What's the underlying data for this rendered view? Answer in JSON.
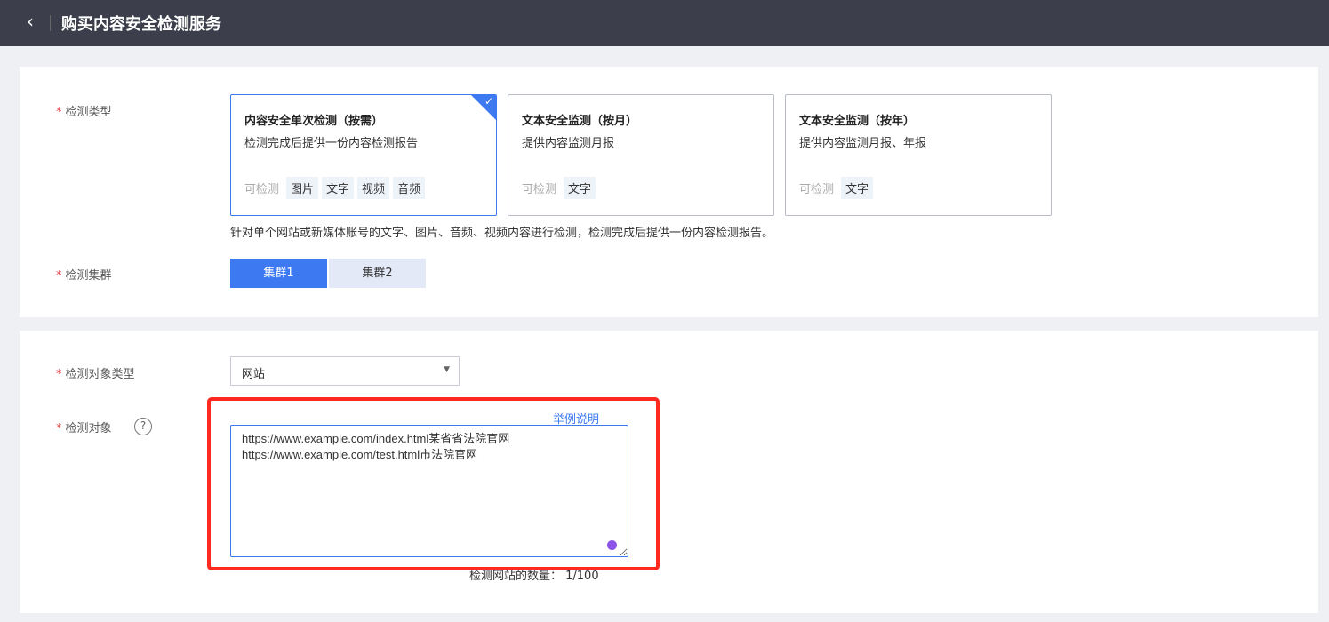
{
  "header": {
    "title": "购买内容安全检测服务",
    "back_icon": "chevron-left"
  },
  "section1": {
    "type_label": "检测类型",
    "options": [
      {
        "title": "内容安全单次检测（按需）",
        "desc": "检测完成后提供一份内容检测报告",
        "caption": "可检测",
        "tags": [
          "图片",
          "文字",
          "视频",
          "音频"
        ],
        "selected": true
      },
      {
        "title": "文本安全监测（按月）",
        "desc": "提供内容监测月报",
        "caption": "可检测",
        "tags": [
          "文字"
        ],
        "selected": false
      },
      {
        "title": "文本安全监测（按年）",
        "desc": "提供内容监测月报、年报",
        "caption": "可检测",
        "tags": [
          "文字"
        ],
        "selected": false
      }
    ],
    "description": "针对单个网站或新媒体账号的文字、图片、音频、视频内容进行检测，检测完成后提供一份内容检测报告。",
    "cluster_label": "检测集群",
    "clusters": [
      "集群1",
      "集群2"
    ],
    "active_cluster": "集群1"
  },
  "section2": {
    "object_type_label": "检测对象类型",
    "object_type_value": "网站",
    "object_label": "检测对象",
    "example_link": "举例说明",
    "textarea_value": "https://www.example.com/index.html某省省法院官网\nhttps://www.example.com/test.html市法院官网",
    "count_text": "检测网站的数量：  1/100"
  },
  "colors": {
    "accent": "#3d7af2",
    "highlight": "#ff2a1f",
    "header_bg": "#3c3f4b"
  }
}
